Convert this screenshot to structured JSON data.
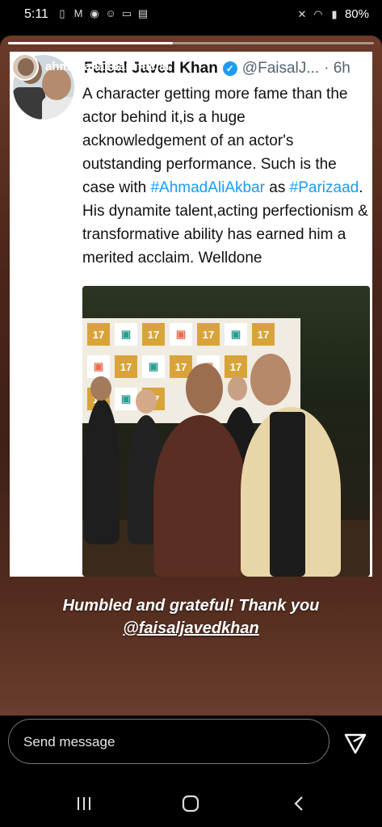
{
  "status_bar": {
    "time": "5:11",
    "battery": "80%"
  },
  "story": {
    "username": "ahmedaliakbarofficial",
    "progress": 0.45,
    "caption_line1": "Humbled and grateful! Thank you",
    "caption_line2": "@faisaljavedkhan"
  },
  "tweet": {
    "author": "Faisal Javed Khan",
    "handle": "@FaisalJ...",
    "time": "· 6h",
    "text_part1": "A character getting more fame than the actor behind it,is a huge acknowledgement of an actor's outstanding performance. Such is the case with ",
    "hashtag1": "#AhmadAliAkbar",
    "text_part2": " as ",
    "hashtag2": "#Parizaad",
    "text_part3": ". His dynamite talent,acting perfectionism & transformative ability has earned him a merited acclaim. Welldone"
  },
  "photo": {
    "tile_text": "17"
  },
  "message": {
    "placeholder": "Send message"
  },
  "colors": {
    "hashtag": "#1d9bf0",
    "story_bg": "#4a2519"
  }
}
